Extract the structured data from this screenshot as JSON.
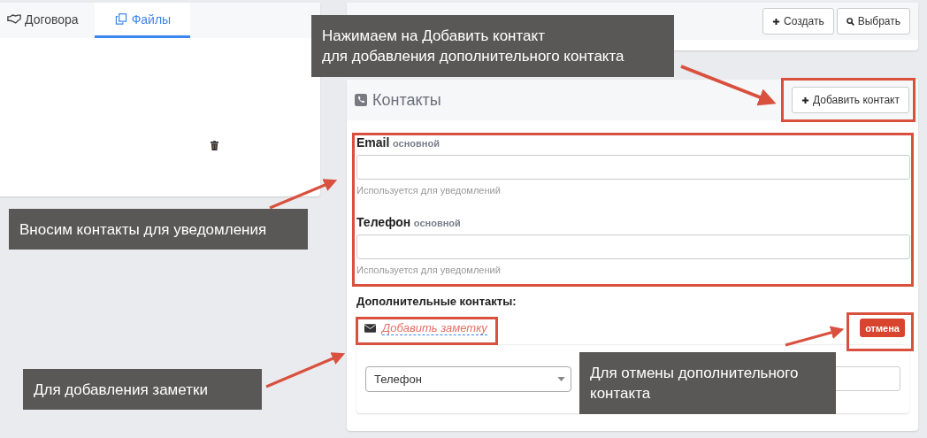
{
  "tabs": [
    {
      "label": "Договора",
      "selected": false
    },
    {
      "label": "Файлы",
      "selected": true
    }
  ],
  "contact_persons": {
    "buttons": [
      "Создать",
      "Выбрать"
    ]
  },
  "contacts": {
    "title": "Контакты",
    "add_button": "Добавить контакт",
    "fields": [
      {
        "label": "Email",
        "tag": "основной",
        "help": "Используется для уведомлений"
      },
      {
        "label": "Телефон",
        "tag": "основной",
        "help": "Используется для уведомлений"
      }
    ],
    "additional_title": "Дополнительные контакты:",
    "note_link": "Добавить заметку",
    "cancel_button": "отмена",
    "extra_contact": {
      "type": "Телефон"
    }
  },
  "callouts": [
    "Нажимаем на Добавить контакт\nдля добавления дополнительного контакта",
    "Вносим контакты для уведомления",
    "Для добавления заметки",
    "Для отмены дополнительного контакта"
  ]
}
